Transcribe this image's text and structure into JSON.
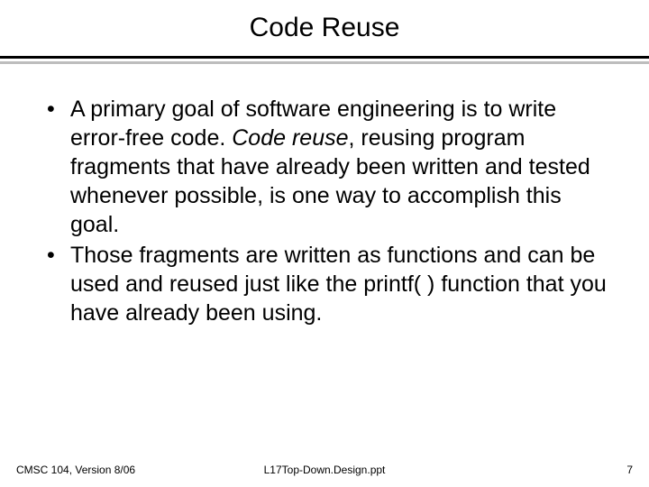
{
  "slide": {
    "title": "Code Reuse",
    "bullets": [
      {
        "pre": "A primary goal of software engineering is to write error-free code.  ",
        "em": "Code reuse",
        "post": ", reusing program fragments that have already been written and tested whenever possible, is one way to accomplish this goal."
      },
      {
        "pre": "Those fragments are written as functions and can be used and reused just like the printf( ) function that you have already been using.",
        "em": "",
        "post": ""
      }
    ],
    "footer": {
      "left": "CMSC 104, Version 8/06",
      "center": "L17Top-Down.Design.ppt",
      "right": "7"
    }
  }
}
